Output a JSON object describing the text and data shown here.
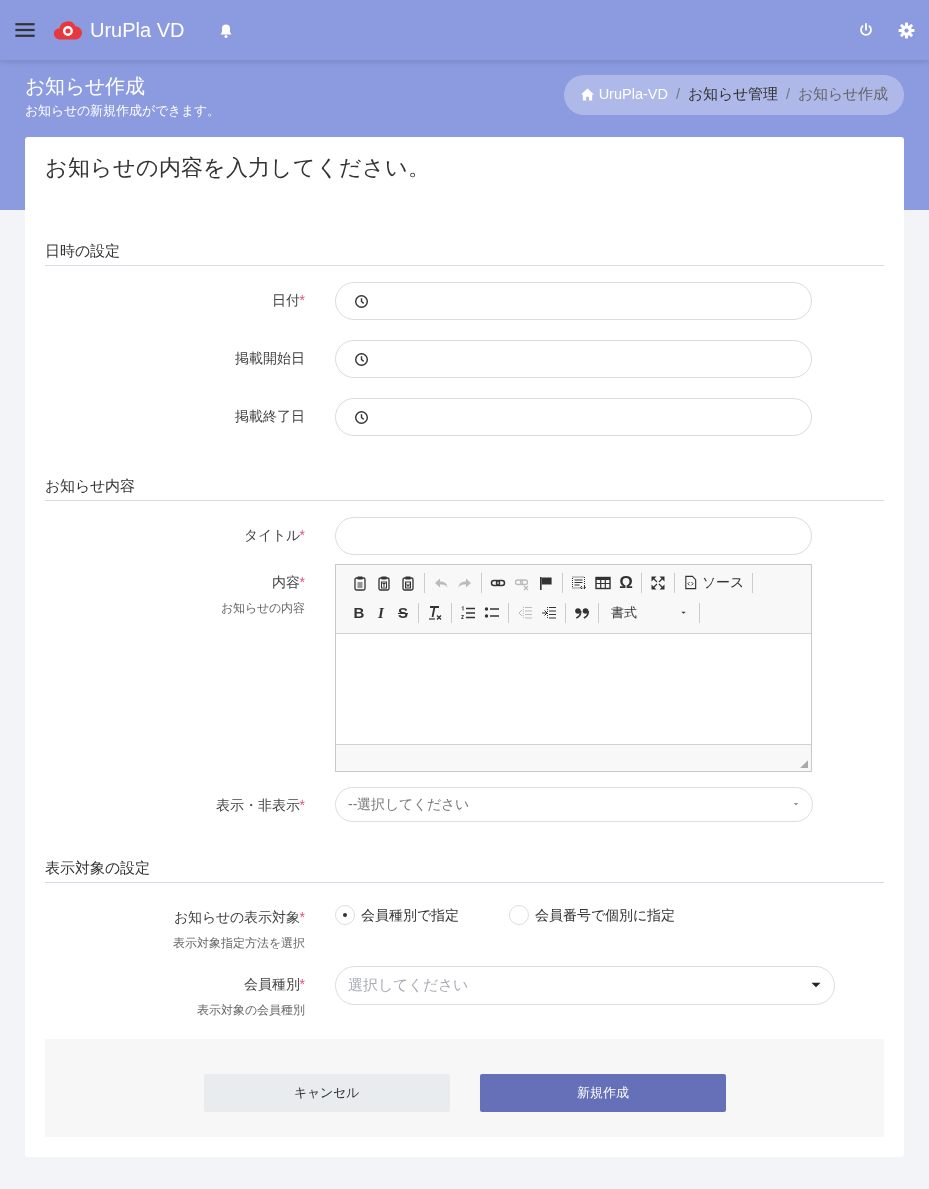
{
  "navbar": {
    "brand": "UruPla VD"
  },
  "header": {
    "title": "お知らせ作成",
    "subtitle": "お知らせの新規作成ができます。",
    "breadcrumb": [
      {
        "label": "UruPla-VD",
        "kind": "home"
      },
      {
        "label": "/",
        "kind": "separator"
      },
      {
        "label": "お知らせ管理",
        "kind": "link"
      },
      {
        "label": "/",
        "kind": "separator"
      },
      {
        "label": "お知らせ作成",
        "kind": "current"
      }
    ]
  },
  "card_title": "お知らせの内容を入力してください。",
  "sections": [
    {
      "title": "日時の設定",
      "fields": [
        {
          "label": "日付",
          "required_mark": "*",
          "kind": "date"
        },
        {
          "label": "掲載開始日",
          "kind": "date"
        },
        {
          "label": "掲載終了日",
          "kind": "date"
        }
      ]
    },
    {
      "title": "お知らせ内容",
      "fields": [
        {
          "label": "タイトル",
          "required_mark": "*",
          "kind": "text"
        },
        {
          "label": "内容",
          "required_mark": "*",
          "hint": "お知らせの内容",
          "kind": "editor"
        },
        {
          "label": "表示・非表示",
          "required_mark": "*",
          "kind": "select",
          "placeholder": "--選択してください"
        }
      ]
    },
    {
      "title": "表示対象の設定",
      "fields": [
        {
          "label": "お知らせの表示対象",
          "required_mark": "*",
          "hint": "表示対象指定方法を選択",
          "kind": "radio",
          "options": [
            {
              "label": "会員種別で指定",
              "selected": true
            },
            {
              "label": "会員番号で個別に指定",
              "selected": false
            }
          ]
        },
        {
          "label": "会員種別",
          "required_mark": "*",
          "hint": "表示対象の会員種別",
          "kind": "select2",
          "placeholder": "選択してください"
        }
      ]
    }
  ],
  "toolbar_rows": [
    [
      [
        {
          "kind": "paste",
          "disabled": false
        },
        {
          "kind": "paste-text",
          "disabled": false
        },
        {
          "kind": "paste-word",
          "disabled": false
        }
      ],
      [
        {
          "kind": "undo",
          "disabled": true
        },
        {
          "kind": "redo",
          "disabled": true
        }
      ],
      [
        {
          "kind": "link",
          "disabled": false
        },
        {
          "kind": "unlink",
          "disabled": true
        },
        {
          "kind": "flag",
          "disabled": false
        }
      ],
      [
        {
          "kind": "blocks",
          "disabled": false
        },
        {
          "kind": "table",
          "disabled": false
        },
        {
          "kind": "char",
          "text": "Ω",
          "disabled": false
        }
      ],
      [
        {
          "kind": "maximize",
          "disabled": false
        }
      ],
      [
        {
          "kind": "source",
          "text": "ソース",
          "disabled": false
        }
      ]
    ],
    [
      [
        {
          "kind": "bold",
          "text": "B",
          "disabled": false
        },
        {
          "kind": "italic",
          "text": "I",
          "disabled": false
        },
        {
          "kind": "strike",
          "text": "S",
          "disabled": false
        }
      ],
      [
        {
          "kind": "clear-format",
          "disabled": false
        }
      ],
      [
        {
          "kind": "numbered-list",
          "disabled": false
        },
        {
          "kind": "bulleted-list",
          "disabled": false
        }
      ],
      [
        {
          "kind": "outdent",
          "disabled": true
        },
        {
          "kind": "indent",
          "disabled": false
        }
      ],
      [
        {
          "kind": "quote",
          "disabled": false
        }
      ],
      [
        {
          "kind": "dropdown",
          "text": "書式",
          "disabled": false
        }
      ]
    ]
  ],
  "buttons": [
    {
      "label": "キャンセル",
      "kind": "secondary"
    },
    {
      "label": "新規作成",
      "kind": "primary"
    }
  ]
}
